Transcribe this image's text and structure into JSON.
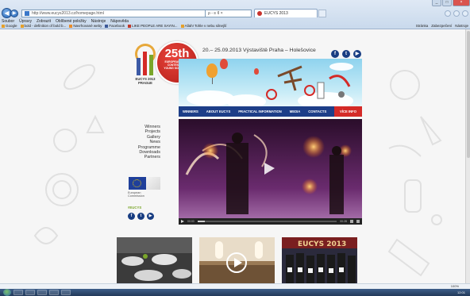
{
  "browser": {
    "address": "http://www.eucys2013.cz/homepage.html",
    "address_tools": "ρ - ≡ ¢ ×",
    "tab_label": "EUCYS 2013",
    "menu": [
      "Soubor",
      "Úpravy",
      "Zobrazit",
      "Oblíbené položky",
      "Nástroje",
      "Nápověda"
    ],
    "favorites": [
      "Google",
      "bold - definition of bold b...",
      "Navrhované weby",
      "Facebook",
      "LIKE PEOPLE ARE SAYIN...",
      "Allah! Tohle v nebu silnejší"
    ],
    "toolbar_right": [
      "Stránka",
      "Zabezpečení",
      "Nástroje"
    ],
    "status_zoom": "100%",
    "tray_time": "12:01"
  },
  "site": {
    "badge": {
      "number": "25th",
      "line1": "EUROPEAN UNION",
      "line2": "CONTEST FOR",
      "line3": "YOUNG SCIENTISTS"
    },
    "header_info": "20.– 25.09.2013  Výstaviště Praha – Holešovice",
    "logo_text_line1": "EUCYS 2013",
    "logo_text_line2": "PRAGUE",
    "nav": [
      "WINNERS",
      "ABOUT EUCYS",
      "PRACTICAL INFORMATION",
      "MEDIA",
      "CONTACTS",
      "VÍCE INFO"
    ],
    "sidenav": [
      "Winners",
      "Projects",
      "Gallery",
      "News",
      "Programme",
      "Downloads",
      "Partners"
    ],
    "eu_caption_1": "European",
    "eu_caption_2": "Commission",
    "eucys_tag": "#EUCYS",
    "video_time_current": "00:00",
    "video_time_total": "00:28"
  },
  "colors": {
    "accent_red": "#d42a27",
    "nav_blue": "#1d3e88",
    "social_blue": "#183d82"
  }
}
